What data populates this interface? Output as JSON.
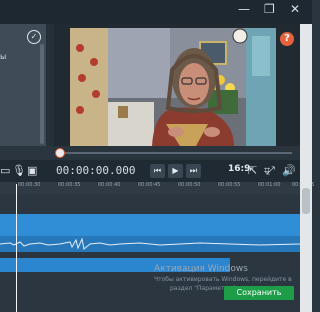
{
  "window": {
    "minimize_glyph": "—",
    "restore_glyph": "❐",
    "close_glyph": "✕"
  },
  "left_panel": {
    "label_fragment": "ы"
  },
  "player": {
    "timecode": "00:00:00.000",
    "aspect_ratio": "16:9",
    "help_glyph": "?"
  },
  "ruler": {
    "ticks": [
      "00:00:30",
      "00:00:35",
      "00:00:40",
      "00:00:45",
      "00:00:50",
      "00:00:55",
      "00:01:00",
      "00:01:05"
    ]
  },
  "watermark": {
    "title": "Активация Windows",
    "line2": "Чтобы активировать Windows, перейдите в",
    "line3": "раздел \"Параметры\"."
  },
  "actions": {
    "save_label": "Сохранить"
  },
  "colors": {
    "accent": "#e5623c",
    "track_blue": "#2f8ed6",
    "save_green": "#1e9d49"
  },
  "icons": [
    "restore-icon",
    "close-icon",
    "check-icon",
    "help-icon",
    "camera-icon",
    "mic-icon",
    "webcam-icon",
    "skip-back-icon",
    "play-icon",
    "skip-forward-icon",
    "export-icon",
    "crop-icon",
    "fullscreen-icon",
    "volume-icon"
  ]
}
